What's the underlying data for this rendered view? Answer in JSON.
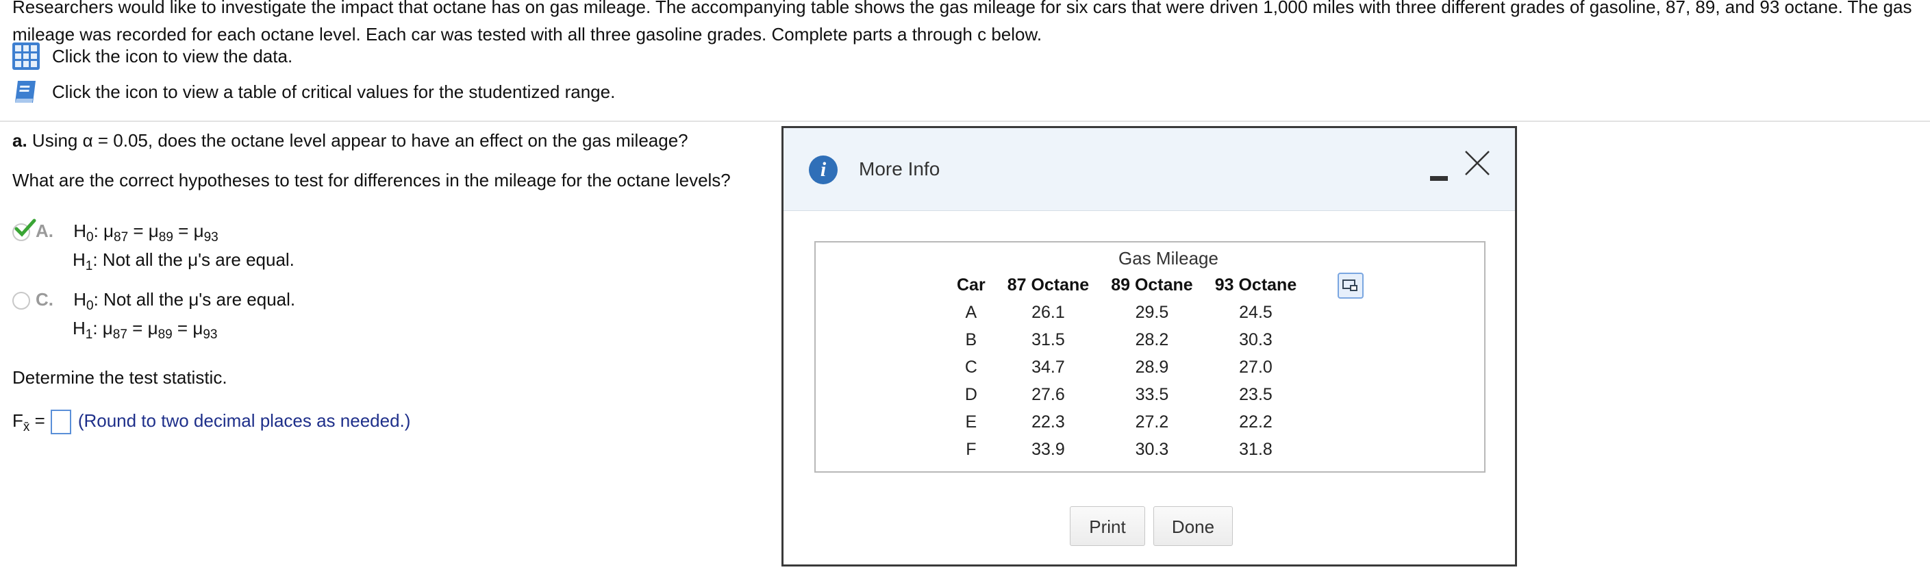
{
  "intro_text": "Researchers would like to investigate the impact that octane has on gas mileage. The accompanying table shows the gas mileage for six cars that were driven 1,000 miles with three different grades of gasoline, 87, 89, and 93 octane. The gas mileage was recorded for each octane level. Each car was tested with all three gasoline grades. Complete parts a through c below.",
  "links": {
    "data_link": "Click the icon to view the data.",
    "critical_values_link": "Click the icon to view a table of critical values for the studentized range."
  },
  "part_a": {
    "label": "a.",
    "question": " Using α = 0.05, does the octane level appear to have an effect on the gas mileage?",
    "hypotheses_question": "What are the correct hypotheses to test for differences in the mileage for the octane levels?",
    "option_a": {
      "letter": "A.",
      "h0_prefix": "H",
      "h0_sub": "0",
      "h0_text": ": μ",
      "h0_s1": "87",
      "eq1": " = μ",
      "h0_s2": "89",
      "eq2": " = μ",
      "h0_s3": "93",
      "h1_prefix": "H",
      "h1_sub": "1",
      "h1_text": ": Not all the μ's are equal.",
      "selected": true
    },
    "option_c": {
      "letter": "C.",
      "h0_prefix": "H",
      "h0_sub": "0",
      "h0_text": ": Not all the μ's are equal.",
      "h1_prefix": "H",
      "h1_sub": "1",
      "h1_text": ": μ",
      "h1_s1": "87",
      "eq1": " = μ",
      "h1_s2": "89",
      "eq2": " = μ",
      "h1_s3": "93",
      "selected": false
    },
    "test_stat_prompt": "Determine the test statistic.",
    "f_label": "F",
    "f_sub": "x̄",
    "f_eq": " =",
    "answer_value": "",
    "round_hint": "(Round to two decimal places as needed.)"
  },
  "dialog": {
    "title": "More Info",
    "table_caption": "Gas Mileage",
    "columns": [
      "Car",
      "87 Octane",
      "89 Octane",
      "93 Octane"
    ],
    "rows": [
      [
        "A",
        "26.1",
        "29.5",
        "24.5"
      ],
      [
        "B",
        "31.5",
        "28.2",
        "30.3"
      ],
      [
        "C",
        "34.7",
        "28.9",
        "27.0"
      ],
      [
        "D",
        "27.6",
        "33.5",
        "23.5"
      ],
      [
        "E",
        "22.3",
        "27.2",
        "22.2"
      ],
      [
        "F",
        "33.9",
        "30.3",
        "31.8"
      ]
    ],
    "print_label": "Print",
    "done_label": "Done"
  },
  "colors": {
    "accent_blue": "#2f6fb8",
    "hint_navy": "#1e2f8a",
    "check_green": "#3aa535"
  }
}
